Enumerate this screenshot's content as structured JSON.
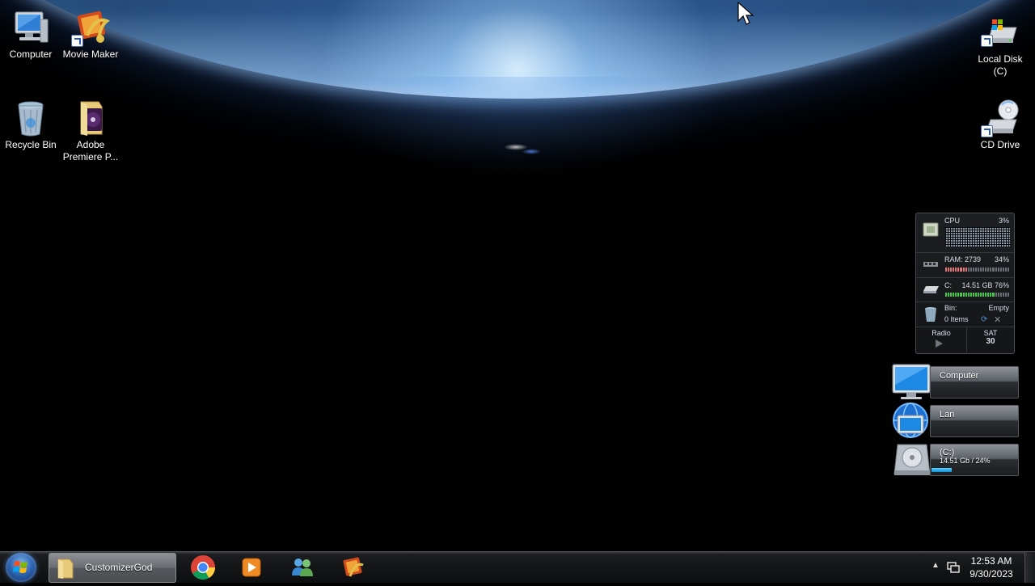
{
  "desktop": {
    "icons": {
      "computer": "Computer",
      "movie_maker": "Movie Maker",
      "recycle_bin": "Recycle Bin",
      "adobe_premiere": "Adobe Premiere P...",
      "local_disk": "Local Disk (C)",
      "cd_drive": "CD Drive"
    }
  },
  "gadget": {
    "cpu_label": "CPU",
    "cpu_value": "3%",
    "ram_label": "RAM: 2739",
    "ram_value": "34%",
    "drive_label": "C:",
    "drive_value": "14.51 GB 76%",
    "bin_label": "Bin:",
    "bin_value": "Empty",
    "bin_items": "0 Items",
    "radio_label": "Radio",
    "day": "SAT",
    "date": "30"
  },
  "drive_gadgets": {
    "computer_title": "Computer",
    "lan_title": "Lan",
    "c_title": "(C:)",
    "c_sub": "14.51 Gb / 24%",
    "c_usage": 0.24
  },
  "taskbar": {
    "folder_label": "CustomizerGod",
    "time": "12:53 AM",
    "date": "9/30/2023"
  }
}
